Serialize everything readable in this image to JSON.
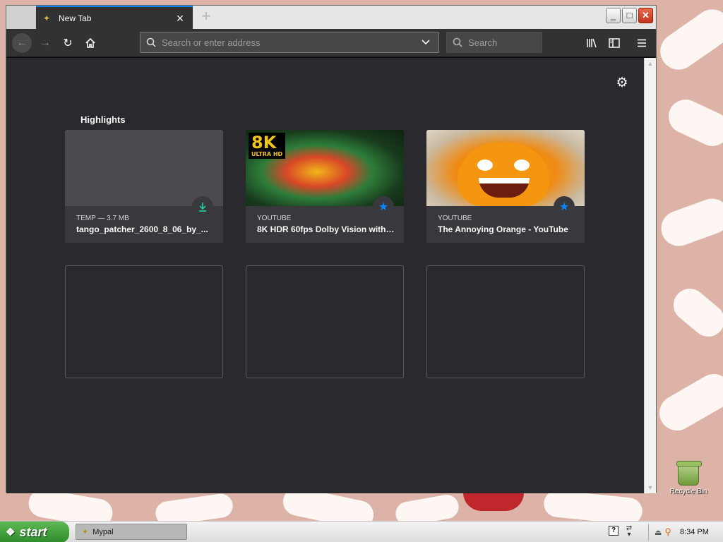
{
  "window": {
    "tab_title": "New Tab",
    "tab_close": "×",
    "new_tab_glyph": "+",
    "controls": {
      "minimize": "_",
      "maximize": "□",
      "close": "✕"
    }
  },
  "toolbar": {
    "url_placeholder": "Search or enter address",
    "search_placeholder": "Search"
  },
  "newtab": {
    "section_title": "Highlights",
    "cards": [
      {
        "context": "TEMP — 3.7 MB",
        "title": "tango_patcher_2600_8_06_by_...",
        "badge": "download-icon"
      },
      {
        "context": "YOUTUBE",
        "title": "8K HDR 60fps Dolby Vision with ...",
        "badge": "star-icon",
        "thumb_text": "8K",
        "thumb_subtext": "ULTRA HD"
      },
      {
        "context": "YOUTUBE",
        "title": "The Annoying Orange - YouTube",
        "badge": "star-icon"
      }
    ]
  },
  "desktop": {
    "recycle_bin_label": "Recycle Bin"
  },
  "taskbar": {
    "start_label": "start",
    "task_item": "Mypal",
    "clock": "8:34 PM"
  },
  "colors": {
    "accent": "#0a84ff",
    "toolbar_bg": "#323234",
    "content_bg": "#2a2a2e",
    "card_bg": "#38383d",
    "download_badge": "#2ac3a2"
  }
}
